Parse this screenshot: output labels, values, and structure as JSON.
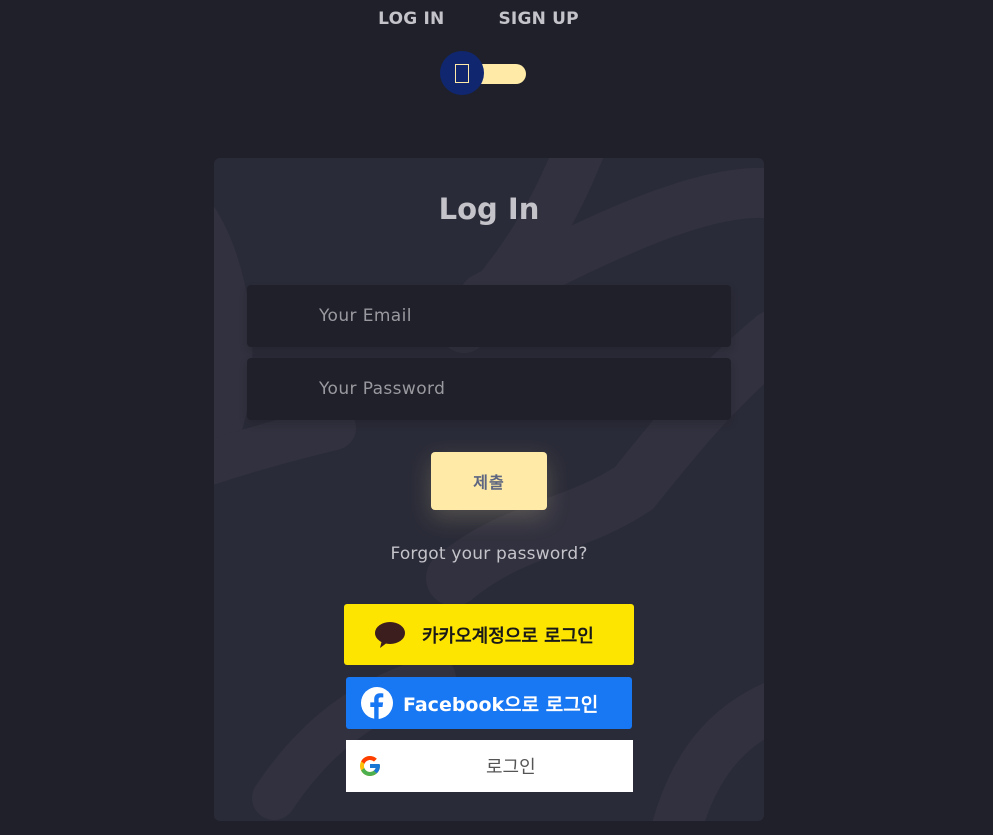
{
  "tabs": {
    "login": "LOG IN",
    "signup": "SIGN UP"
  },
  "card": {
    "title": "Log In",
    "email_placeholder": "Your Email",
    "password_placeholder": "Your Password",
    "submit_label": "제출",
    "forgot_link": "Forgot your password?"
  },
  "social": {
    "kakao_label": "카카오계정으로 로그인",
    "facebook_label": "Facebook으로 로그인",
    "google_label": "로그인"
  },
  "colors": {
    "background": "#1f2029",
    "card": "#2a2b38",
    "accent": "#ffeba7",
    "toggle_knob": "#102770",
    "kakao": "#fee500",
    "facebook": "#1877f2",
    "google": "#ffffff"
  },
  "icons": {
    "toggle": "missing-glyph-icon",
    "email": "at-icon",
    "password": "lock-icon",
    "kakao": "speech-bubble-icon",
    "facebook": "facebook-icon",
    "google": "google-icon"
  }
}
